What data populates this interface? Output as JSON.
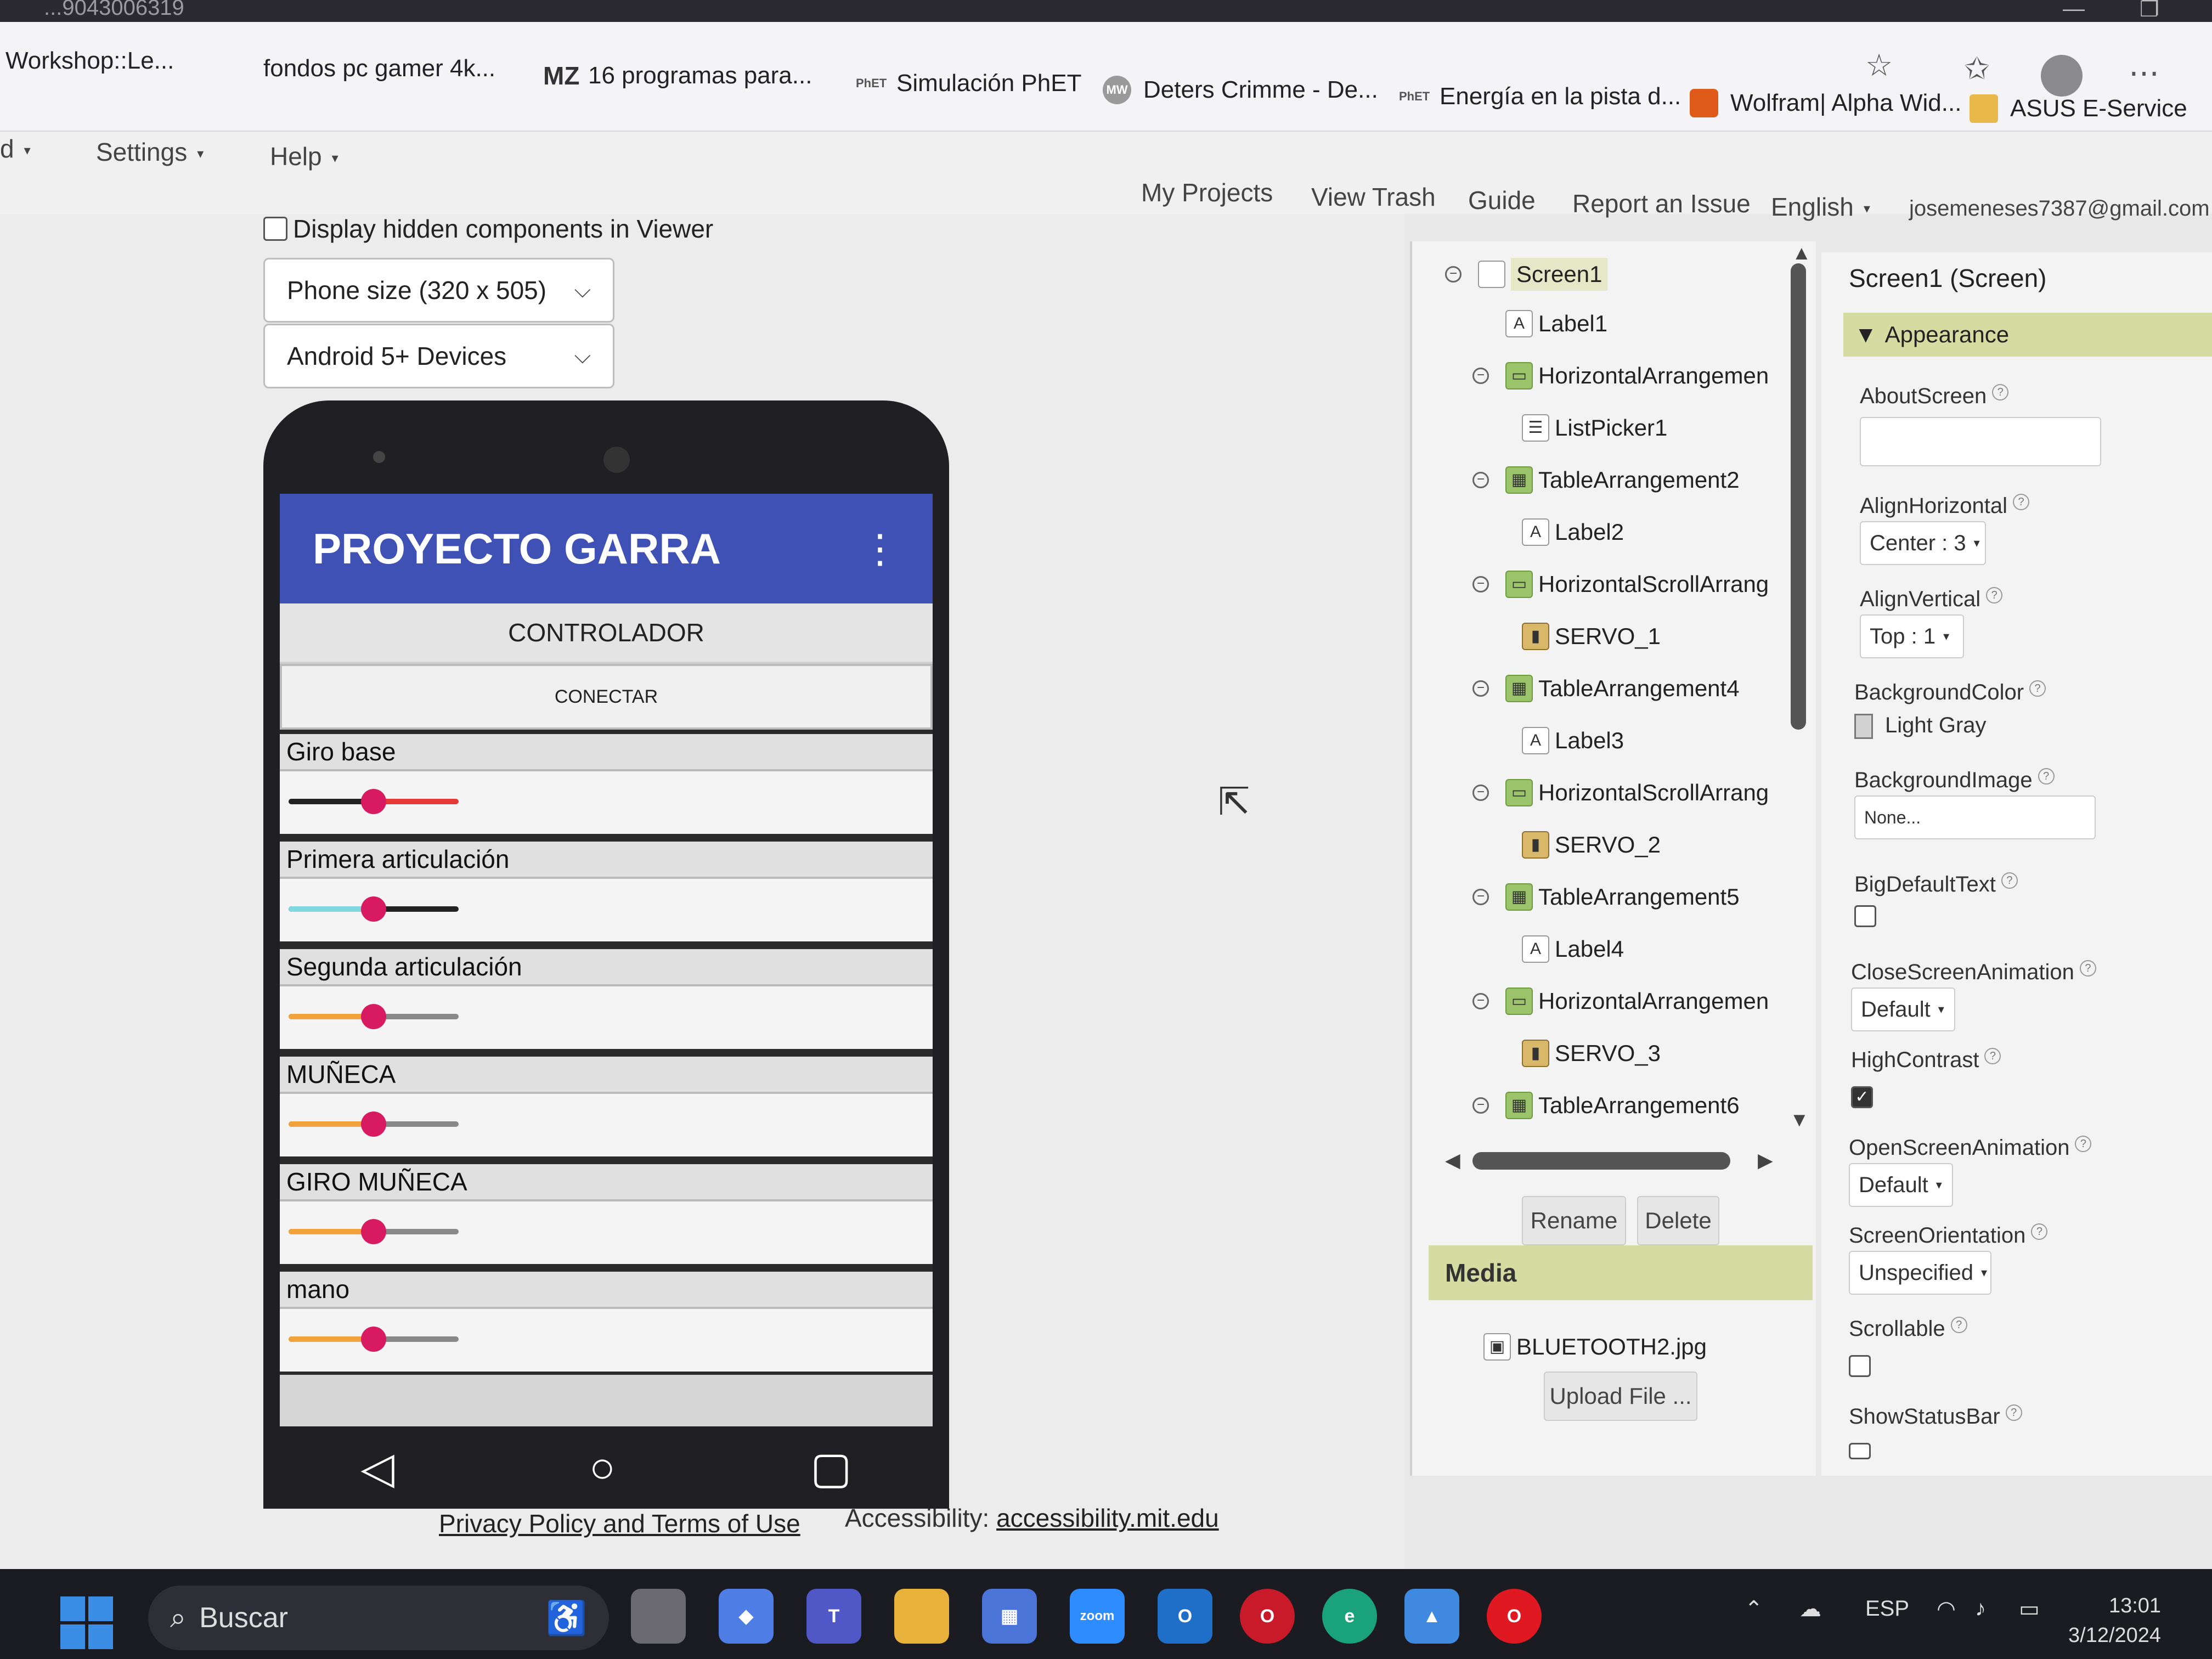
{
  "browser": {
    "url_partial": "...9043006319",
    "bookmarks": [
      {
        "label": "Workshop::Le...",
        "icon": "bookmark-icon"
      },
      {
        "label": "fondos pc gamer 4k...",
        "icon": "bookmark-icon"
      },
      {
        "label": "16 programas para...",
        "icon_text": "MZ"
      },
      {
        "label": "Simulación PhET",
        "icon_text": "PhET"
      },
      {
        "label": "Deters Crimme - De...",
        "icon_text": "MW"
      },
      {
        "label": "Energía en la pista d...",
        "icon_text": "PhET"
      },
      {
        "label": "Wolfram| Alpha Wid...",
        "icon": "wolfram-icon"
      },
      {
        "label": "ASUS E-Service",
        "icon": "folder-icon"
      }
    ]
  },
  "menu": {
    "left": [
      {
        "label": "d"
      },
      {
        "label": "Settings"
      },
      {
        "label": "Help"
      }
    ],
    "right": {
      "my_projects": "My Projects",
      "view_trash": "View Trash",
      "guide": "Guide",
      "report": "Report an Issue",
      "language": "English",
      "account": "josemeneses7387@gmail.com"
    }
  },
  "viewer": {
    "hidden_components": "Display hidden components in Viewer",
    "phone_size": "Phone size (320 x 505)",
    "device": "Android 5+ Devices",
    "app_title": "PROYECTO GARRA",
    "controller_label": "CONTROLADOR",
    "connect_button": "CONECTAR",
    "rows": [
      {
        "label": "Giro base",
        "slider_value": 0.5,
        "fill_color": "#222222",
        "track_color": "#e53935"
      },
      {
        "label": "Primera articulación",
        "slider_value": 0.5,
        "fill_color": "#7fd7e0",
        "track_color": "#222222"
      },
      {
        "label": "Segunda articulación",
        "slider_value": 0.5,
        "fill_color": "#f2a23a",
        "track_color": "#888888"
      },
      {
        "label": "MUÑECA",
        "slider_value": 0.5,
        "fill_color": "#f2a23a",
        "track_color": "#888888"
      },
      {
        "label": "GIRO MUÑECA",
        "slider_value": 0.5,
        "fill_color": "#f2a23a",
        "track_color": "#888888"
      },
      {
        "label": "mano",
        "slider_value": 0.5,
        "fill_color": "#f2a23a",
        "track_color": "#888888"
      }
    ],
    "privacy": "Privacy Policy and Terms of Use",
    "accessibility_label": "Accessibility:",
    "accessibility_link": "accessibility.mit.edu"
  },
  "components": {
    "tree": [
      {
        "label": "Screen1",
        "toggle": "⊖",
        "icon": "screen-icon",
        "level": 0,
        "selected": true
      },
      {
        "label": "Label1",
        "toggle": "",
        "icon": "A",
        "level": 1
      },
      {
        "label": "HorizontalArrangemen",
        "toggle": "⊖",
        "icon": "ha",
        "level": 1
      },
      {
        "label": "ListPicker1",
        "toggle": "",
        "icon": "list",
        "level": 2
      },
      {
        "label": "TableArrangement2",
        "toggle": "⊖",
        "icon": "ta",
        "level": 1
      },
      {
        "label": "Label2",
        "toggle": "",
        "icon": "A",
        "level": 2
      },
      {
        "label": "HorizontalScrollArrang",
        "toggle": "⊖",
        "icon": "ha",
        "level": 1
      },
      {
        "label": "SERVO_1",
        "toggle": "",
        "icon": "sl",
        "level": 2
      },
      {
        "label": "TableArrangement4",
        "toggle": "⊖",
        "icon": "ta",
        "level": 1
      },
      {
        "label": "Label3",
        "toggle": "",
        "icon": "A",
        "level": 2
      },
      {
        "label": "HorizontalScrollArrang",
        "toggle": "⊖",
        "icon": "ha",
        "level": 1
      },
      {
        "label": "SERVO_2",
        "toggle": "",
        "icon": "sl",
        "level": 2
      },
      {
        "label": "TableArrangement5",
        "toggle": "⊖",
        "icon": "ta",
        "level": 1
      },
      {
        "label": "Label4",
        "toggle": "",
        "icon": "A",
        "level": 2
      },
      {
        "label": "HorizontalArrangemen",
        "toggle": "⊖",
        "icon": "ha",
        "level": 1
      },
      {
        "label": "SERVO_3",
        "toggle": "",
        "icon": "sl",
        "level": 2
      },
      {
        "label": "TableArrangement6",
        "toggle": "⊖",
        "icon": "ta",
        "level": 1
      }
    ],
    "rename": "Rename",
    "delete": "Delete",
    "media_header": "Media",
    "media_file": "BLUETOOTH2.jpg",
    "upload": "Upload File ..."
  },
  "properties": {
    "title": "Screen1 (Screen)",
    "group": "Appearance",
    "about_screen": "AboutScreen",
    "align_h": "AlignHorizontal",
    "align_h_value": "Center : 3",
    "align_v": "AlignVertical",
    "align_v_value": "Top : 1",
    "bg_color": "BackgroundColor",
    "bg_color_value": "Light Gray",
    "bg_image": "BackgroundImage",
    "bg_image_value": "None...",
    "big_default_text": "BigDefaultText",
    "close_anim": "CloseScreenAnimation",
    "close_anim_value": "Default",
    "high_contrast": "HighContrast",
    "open_anim": "OpenScreenAnimation",
    "open_anim_value": "Default",
    "orientation": "ScreenOrientation",
    "orientation_value": "Unspecified",
    "scrollable": "Scrollable",
    "show_status_bar": "ShowStatusBar"
  },
  "taskbar": {
    "search": "Buscar",
    "apps": [
      "zoom"
    ],
    "lang": "ESP",
    "time": "13:01",
    "date": "3/12/2024"
  }
}
